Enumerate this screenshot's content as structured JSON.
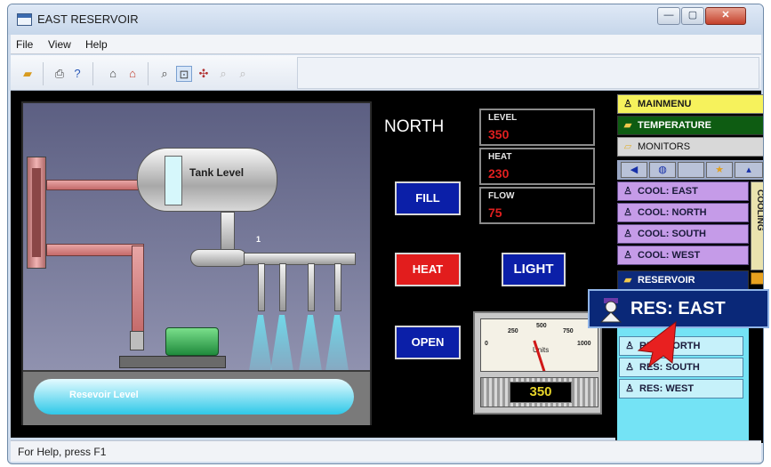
{
  "window": {
    "title": "EAST RESERVOIR"
  },
  "menu": {
    "file": "File",
    "view": "View",
    "help": "Help"
  },
  "scene": {
    "tank_label": "Tank Level",
    "reservoir_label": "Resevoir Level",
    "valve_tag": "1"
  },
  "display": {
    "title": "NORTH"
  },
  "readouts": [
    {
      "label": "LEVEL",
      "value": "350"
    },
    {
      "label": "HEAT",
      "value": "230"
    },
    {
      "label": "FLOW",
      "value": "75"
    }
  ],
  "buttons": {
    "fill": "FILL",
    "heat": "HEAT",
    "open": "OPEN",
    "light": "LIGHT"
  },
  "meter": {
    "ticks": [
      "0",
      "250",
      "500",
      "750",
      "1000"
    ],
    "units": "Units",
    "value": "350",
    "max": "1000"
  },
  "nav": {
    "main": "MAINMENU",
    "temperature": "TEMPERATURE",
    "monitors": "MONITORS",
    "cool_items": [
      "COOL: EAST",
      "COOL: NORTH",
      "COOL: SOUTH",
      "COOL: WEST"
    ],
    "cooling_tab": "COOLING",
    "reservoir": "RESERVOIR",
    "res_items": [
      "RES: NORTH",
      "RES: SOUTH",
      "RES: WEST"
    ]
  },
  "popup": {
    "label": "RES: EAST"
  },
  "status": {
    "text": "For Help, press F1"
  },
  "colors": {
    "alarm_red": "#e21d1d",
    "button_blue": "#0b1fa8",
    "value_red": "#e11f1f",
    "nav_green": "#0e5c12"
  }
}
